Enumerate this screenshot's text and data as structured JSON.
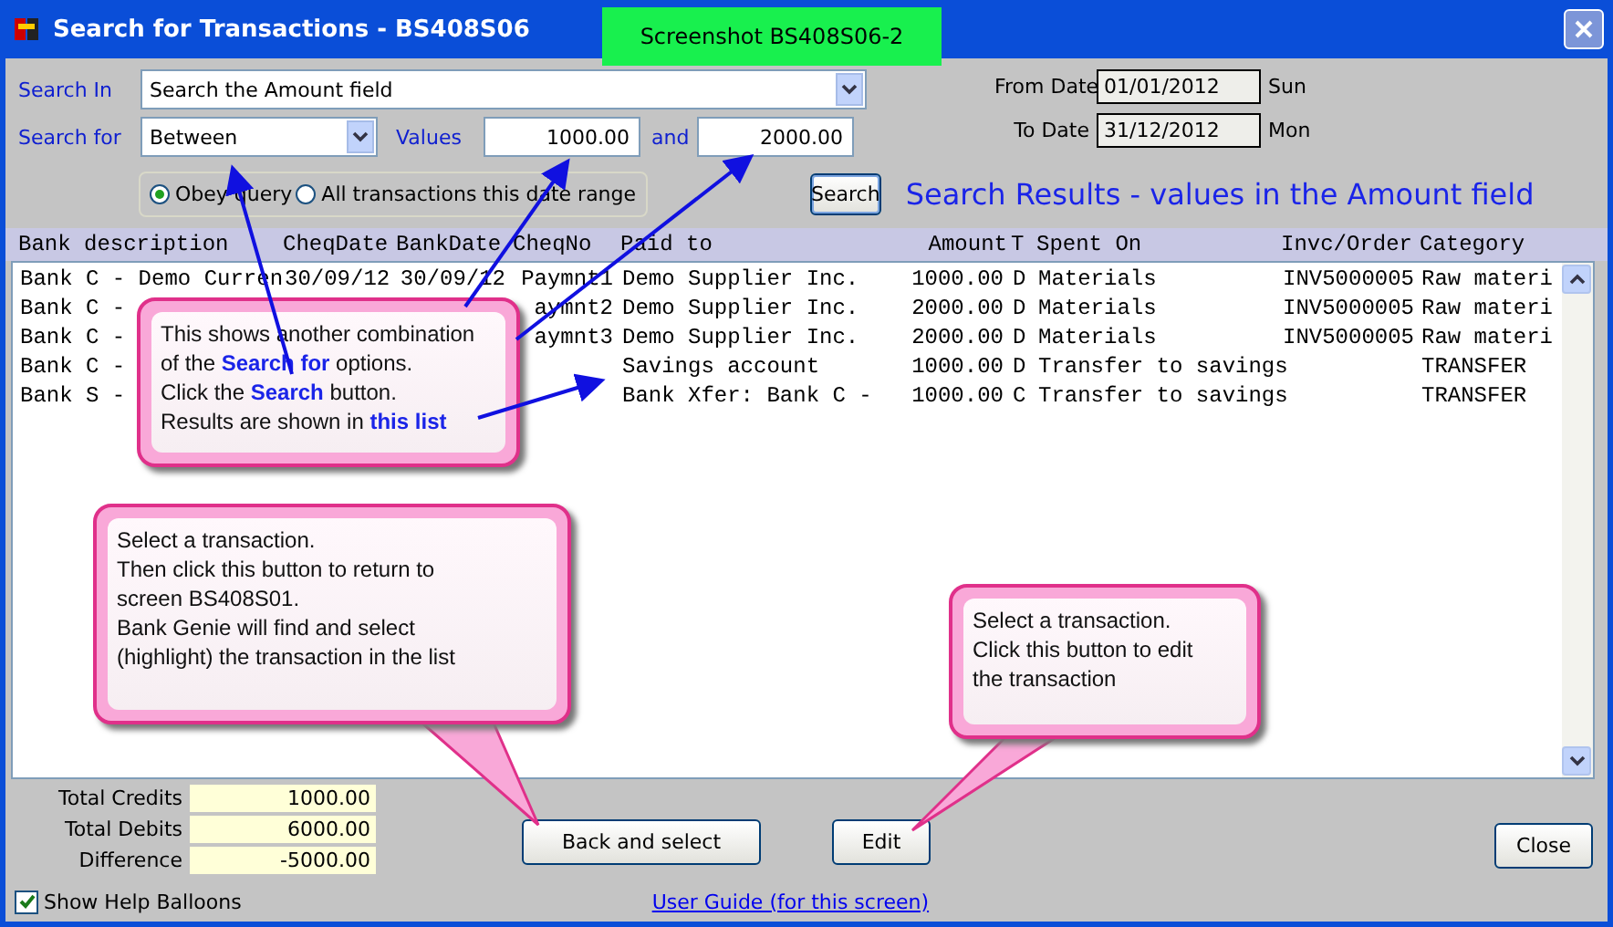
{
  "window": {
    "title": "Search for Transactions - BS408S06"
  },
  "screenshot_label": "Screenshot BS408S06-2",
  "search_in": {
    "label": "Search In",
    "value": "Search the Amount field"
  },
  "search_for": {
    "label": "Search for",
    "value": "Between",
    "values_label": "Values",
    "value_from": "1000.00",
    "and_label": "and",
    "value_to": "2000.00"
  },
  "scope": [
    {
      "label": "Obey query",
      "selected": true
    },
    {
      "label": "All transactions this date range",
      "selected": false
    }
  ],
  "search_button": "Search",
  "results_title": "Search Results - values in the Amount field",
  "dates": [
    {
      "label": "From Date",
      "value": "01/01/2012",
      "day": "Sun"
    },
    {
      "label": "To Date",
      "value": "31/12/2012",
      "day": "Mon"
    }
  ],
  "table": {
    "columns": [
      "Bank description",
      "CheqDate",
      "BankDate",
      "CheqNo",
      "Paid to",
      "Amount",
      "T",
      "Spent On",
      "Invc/Order",
      "Category"
    ],
    "rows": [
      {
        "description": "Bank C - Demo Curren",
        "cheq_date": "30/09/12",
        "bank_date": "30/09/12",
        "cheq_no": "Paymnt1",
        "paid_to": "Demo Supplier Inc.",
        "amount": "1000.00",
        "type": "D",
        "spent_on": "Materials",
        "invoice": "INV5000005",
        "category": "Raw materi"
      },
      {
        "description": "Bank C -",
        "cheq_no": "aymnt2",
        "paid_to": "Demo Supplier Inc.",
        "amount": "2000.00",
        "type": "D",
        "spent_on": "Materials",
        "invoice": "INV5000005",
        "category": "Raw materi"
      },
      {
        "description": "Bank C -",
        "cheq_no": "aymnt3",
        "paid_to": "Demo Supplier Inc.",
        "amount": "2000.00",
        "type": "D",
        "spent_on": "Materials",
        "invoice": "INV5000005",
        "category": "Raw materi"
      },
      {
        "description": "Bank C -",
        "paid_to": "Savings account",
        "amount": "1000.00",
        "type": "D",
        "spent_on": "Transfer to savings",
        "category": "TRANSFER"
      },
      {
        "description": "Bank S -",
        "paid_to": "Bank Xfer: Bank C -",
        "amount": "1000.00",
        "type": "C",
        "spent_on": "Transfer to savings",
        "category": "TRANSFER"
      }
    ]
  },
  "totals": [
    {
      "label": "Total Credits",
      "value": "1000.00"
    },
    {
      "label": "Total Debits",
      "value": "6000.00"
    },
    {
      "label": "Difference",
      "value": "-5000.00"
    }
  ],
  "buttons": {
    "back": "Back and select",
    "edit": "Edit",
    "close": "Close"
  },
  "show_help_balloons": {
    "label": "Show Help Balloons",
    "checked": true
  },
  "user_guide_link": "User Guide (for this screen)",
  "balloons": [
    {
      "lines": [
        "This shows another combination",
        "of the **Search for** options.",
        "Click the **Search** button.",
        "Results are shown in **this list**"
      ]
    },
    {
      "lines": [
        "Select a transaction.",
        "Then click this button to return to",
        "screen BS408S01.",
        "Bank Genie will find and select",
        "(highlight) the transaction in the list"
      ]
    },
    {
      "lines": [
        "Select a transaction.",
        "Click this button to edit",
        "the transaction"
      ]
    }
  ]
}
